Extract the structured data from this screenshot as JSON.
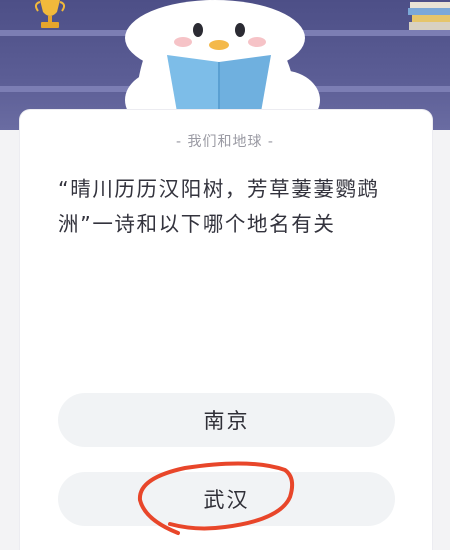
{
  "header": {
    "trophy_icon": "trophy-icon",
    "books_icon": "books-icon",
    "mascot_icon": "penguin-reading-book-icon",
    "background_color": "#5b5d95"
  },
  "quiz": {
    "category": "- 我们和地球 -",
    "question": "“晴川历历汉阳树，芳草萋萋鹦鹉洲”一诗和以下哪个地名有关",
    "options": [
      {
        "label": "南京"
      },
      {
        "label": "武汉"
      }
    ]
  },
  "annotation": {
    "circled_option": "武汉",
    "color": "#e8462a"
  }
}
